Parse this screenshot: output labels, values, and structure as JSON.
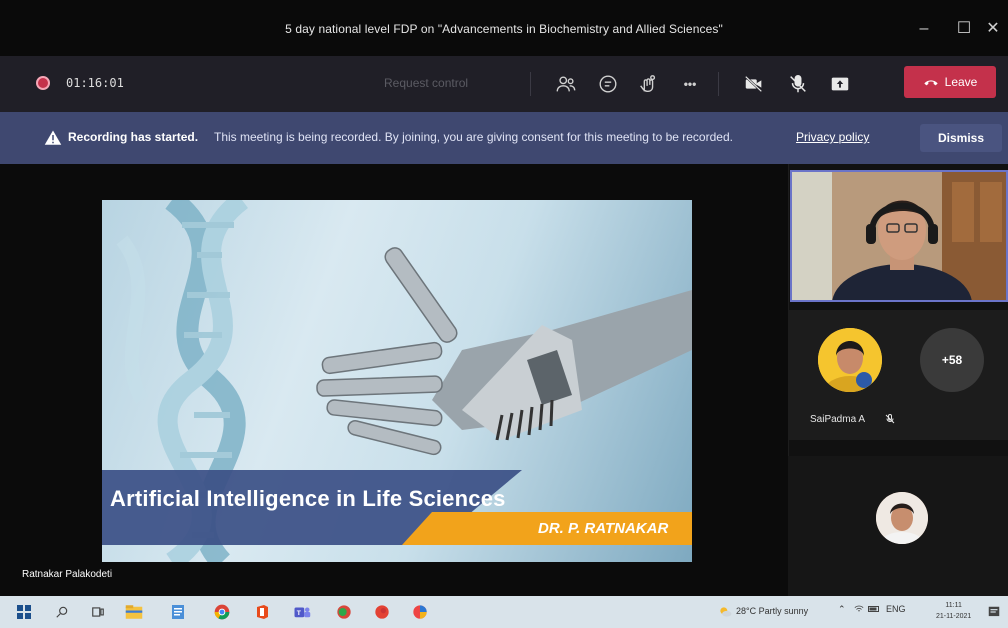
{
  "window": {
    "title": "5 day national level FDP on \"Advancements in Biochemistry and Allied Sciences\"",
    "minimize_glyph": "–",
    "maximize_glyph": "☐",
    "close_glyph": "✕"
  },
  "toolbar": {
    "timer": "01:16:01",
    "request_control": "Request control",
    "leave_label": "Leave",
    "more_glyph": "•••",
    "icons": [
      "participants-icon",
      "chat-icon",
      "reactions-icon",
      "more-icon",
      "camera-off-icon",
      "mic-off-icon",
      "share-icon",
      "phone-icon"
    ]
  },
  "banner": {
    "bold": "Recording has started.",
    "text": "This meeting is being recorded. By joining, you are giving consent for this meeting to be recorded.",
    "link": "Privacy policy",
    "dismiss": "Dismiss"
  },
  "stage": {
    "slide_title": "Artificial Intelligence in Life Sciences",
    "slide_author": "DR. P. RATNAKAR",
    "presenter": "Ratnakar Palakodeti"
  },
  "participants": {
    "tile1_name": "SaiPadma A",
    "overflow_count": "+58"
  },
  "taskbar": {
    "weather": "28°C  Partly sunny",
    "lang": "ENG",
    "time": "11:11",
    "date": "21-11-2021"
  },
  "colors": {
    "leave": "#c4314b",
    "banner": "#3f4870",
    "toolbar": "#201f27",
    "accent": "#6b74c8"
  }
}
